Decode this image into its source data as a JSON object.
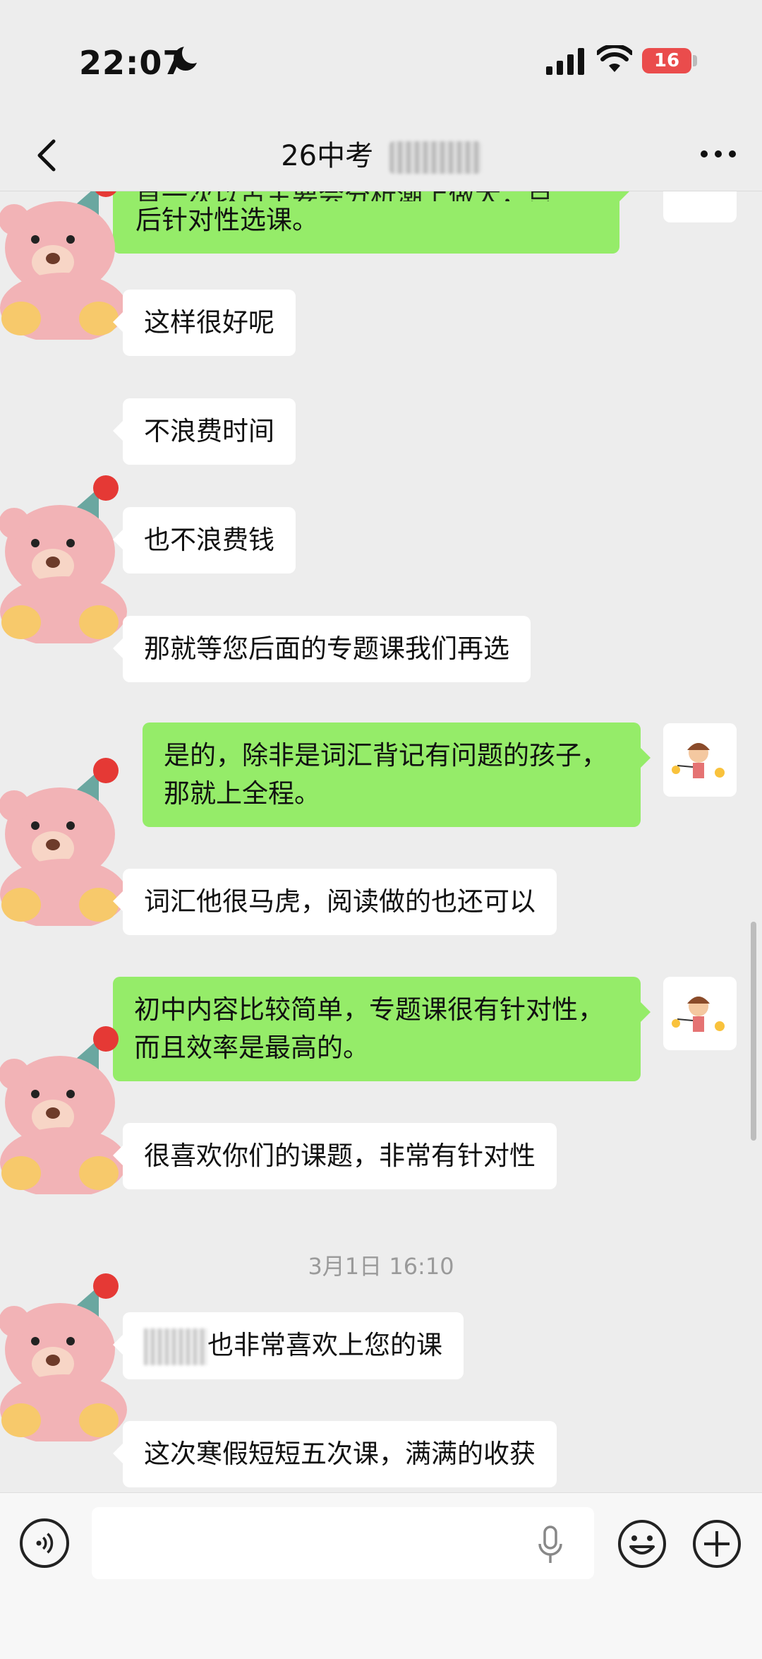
{
  "status": {
    "time": "22:07",
    "battery": "16"
  },
  "header": {
    "title": "26中考"
  },
  "messages": [
    {
      "side": "out",
      "text": "后针对性选课。"
    },
    {
      "side": "in",
      "text": "这样很好呢"
    },
    {
      "side": "in",
      "text": "不浪费时间"
    },
    {
      "side": "in",
      "text": "也不浪费钱"
    },
    {
      "side": "in",
      "text": "那就等您后面的专题课我们再选"
    },
    {
      "side": "out",
      "text": "是的，除非是词汇背记有问题的孩子，那就上全程。"
    },
    {
      "side": "in",
      "text": "词汇他很马虎，阅读做的也还可以"
    },
    {
      "side": "out",
      "text": "初中内容比较简单，专题课很有针对性，而且效率是最高的。"
    },
    {
      "side": "in",
      "text": "很喜欢你们的课题，非常有针对性"
    },
    {
      "side": "in",
      "text": "也非常喜欢上您的课"
    },
    {
      "side": "in",
      "text": "这次寒假短短五次课，满满的收获"
    }
  ],
  "timestamp": "3月1日 16:10",
  "icons": {
    "back": "back-chevron-icon",
    "more": "more-icon",
    "voice": "voice-icon",
    "mic": "microphone-icon",
    "emoji": "emoji-icon",
    "plus": "plus-icon"
  },
  "colors": {
    "outgoing_bubble": "#95ec69",
    "incoming_bubble": "#ffffff",
    "background": "#ededed"
  }
}
